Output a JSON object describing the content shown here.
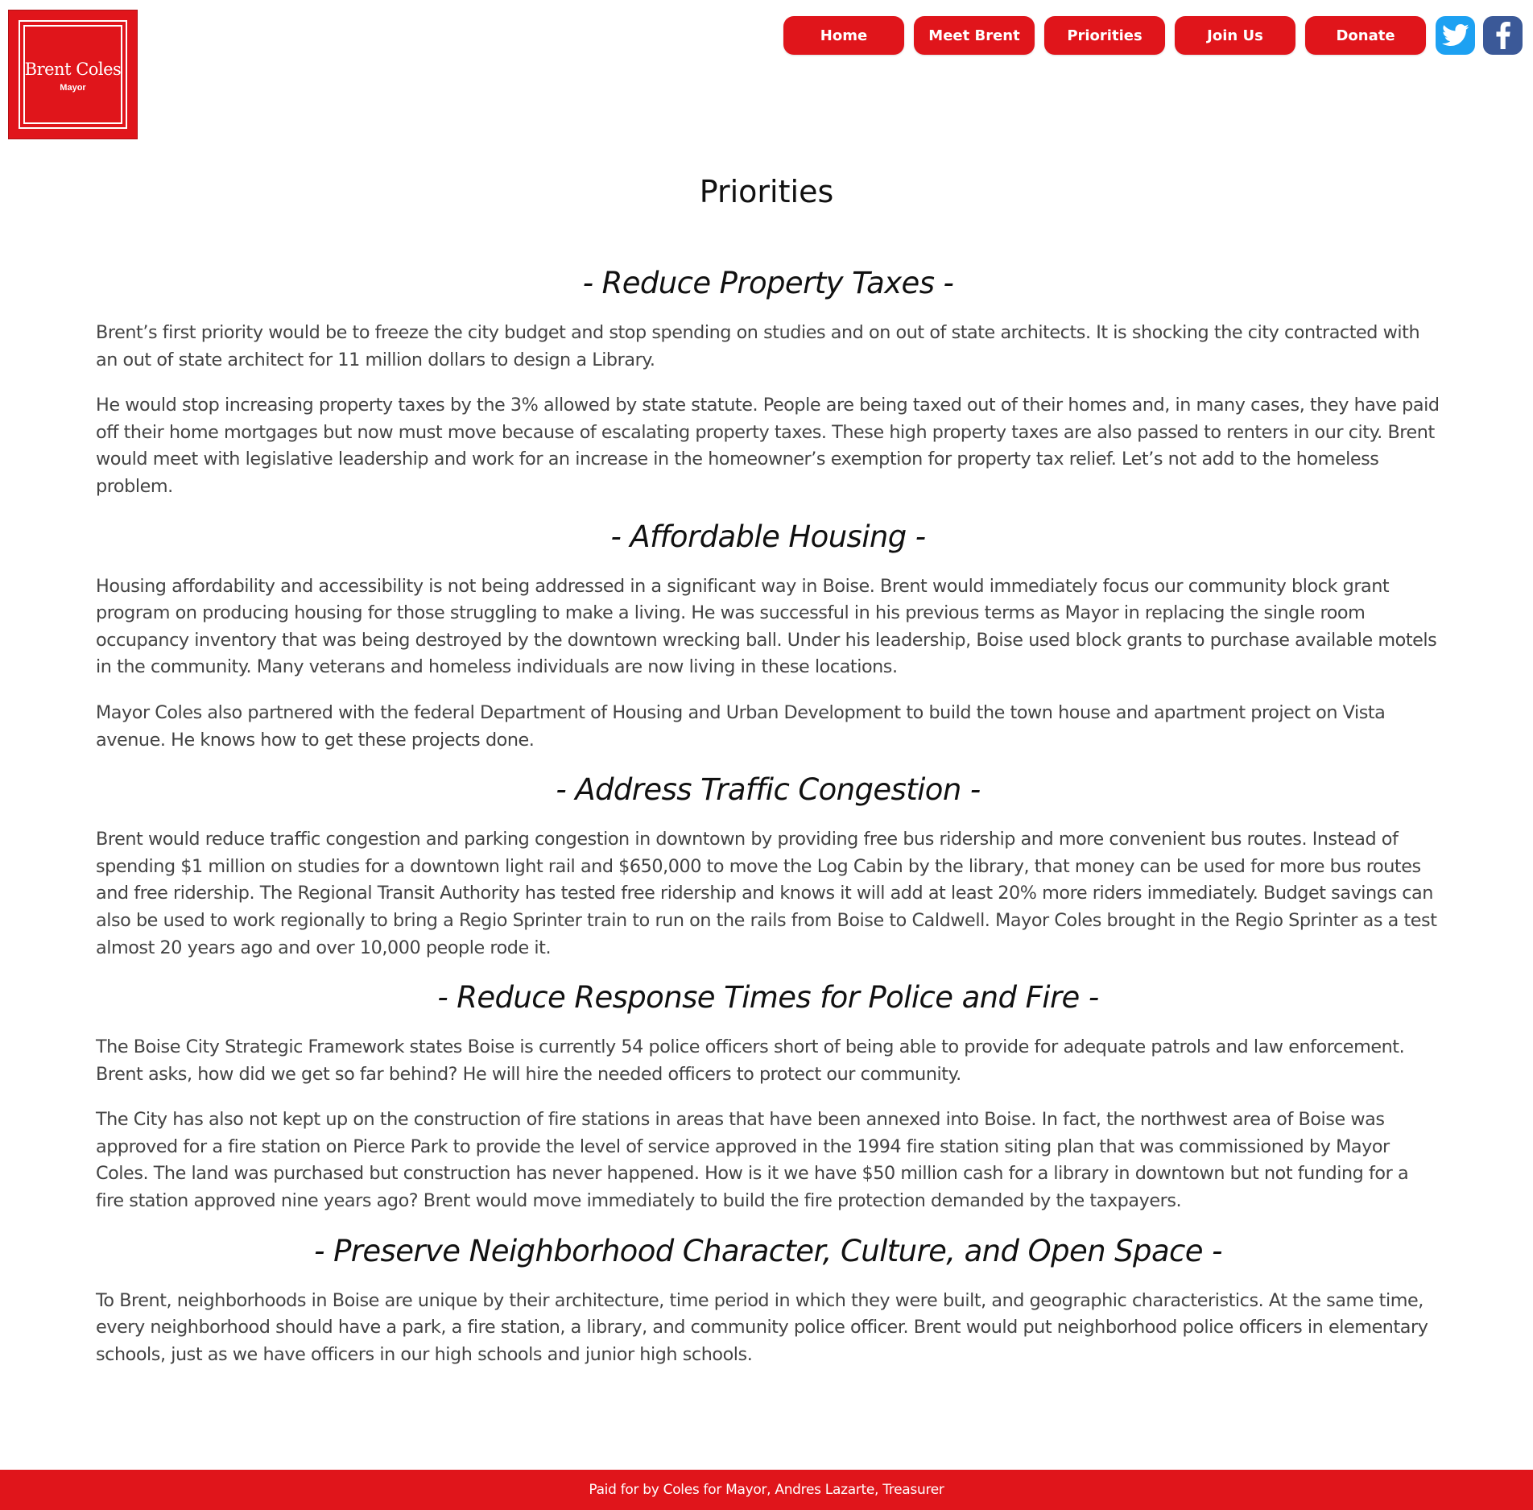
{
  "logo": {
    "name": "Brent Coles",
    "subtitle": "Mayor"
  },
  "nav": {
    "items": [
      {
        "label": "Home"
      },
      {
        "label": "Meet Brent"
      },
      {
        "label": "Priorities"
      },
      {
        "label": "Join Us"
      },
      {
        "label": "Donate"
      }
    ],
    "social": [
      {
        "icon": "twitter-icon",
        "color": "#1da1f2"
      },
      {
        "icon": "facebook-icon",
        "color": "#3b5998"
      }
    ]
  },
  "colors": {
    "brand_red": "#e0151b",
    "text": "#444444",
    "heading": "#111111"
  },
  "page": {
    "title": "Priorities"
  },
  "sections": [
    {
      "heading": "- Reduce Property Taxes -",
      "paragraphs": [
        "Brent’s first priority would be to freeze the city budget and stop spending on studies and on out of state architects. It is shocking the city contracted with an out of state architect for 11 million dollars to design a Library.",
        "He would stop increasing property taxes by the 3% allowed by state statute. People are being taxed out of their homes and, in many cases, they have paid off their home mortgages but now must move because of escalating property taxes. These high property taxes are also passed to renters in our city. Brent would meet with legislative leadership and work for an increase in the homeowner’s exemption for property tax relief. Let’s not add to the homeless problem."
      ]
    },
    {
      "heading": "- Affordable Housing -",
      "paragraphs": [
        "Housing affordability and accessibility is not being addressed in a significant way in Boise. Brent would immediately focus our community block grant program on producing housing for those struggling to make a living. He was successful in his previous terms as Mayor in replacing the single room occupancy inventory that was being destroyed by the downtown wrecking ball. Under his leadership, Boise used block grants to purchase available motels in the community. Many veterans and homeless individuals are now living in these locations.",
        "Mayor Coles also partnered with the federal Department of Housing and Urban Development to build the town house and apartment project on Vista avenue. He knows how to get these projects done."
      ]
    },
    {
      "heading": "- Address Traffic Congestion -",
      "paragraphs": [
        "Brent would reduce traffic congestion and parking congestion in downtown by providing free bus ridership and more convenient bus routes. Instead of spending $1 million on studies for a downtown light rail and $650,000 to move the Log Cabin by the library, that money can be used for more bus routes and free ridership. The Regional Transit Authority has tested free ridership and knows it will add at least 20% more riders immediately. Budget savings can also be used to work regionally to bring a Regio Sprinter train to run on the rails from Boise to Caldwell. Mayor Coles brought in the Regio Sprinter as a test almost 20 years ago and over 10,000 people rode it."
      ]
    },
    {
      "heading": "- Reduce Response Times for Police and Fire -",
      "paragraphs": [
        "The Boise City Strategic Framework states Boise is currently 54 police officers short of being able to provide for adequate patrols and law enforcement. Brent asks, how did we get so far behind? He will hire the needed officers to protect our community.",
        "The City has also not kept up on the construction of fire stations in areas that have been annexed into Boise. In fact, the northwest area of Boise was approved for a fire station on Pierce Park to provide the level of service approved in the 1994 fire station siting plan that was commissioned by Mayor Coles. The land was purchased but construction has never happened. How is it we have $50 million cash for a library in downtown but not funding for a fire station approved nine years ago? Brent would move immediately to build the fire protection demanded by the taxpayers."
      ]
    },
    {
      "heading": "- Preserve Neighborhood Character, Culture, and Open Space -",
      "paragraphs": [
        "To Brent, neighborhoods in Boise are unique by their architecture, time period in which they were built, and geographic characteristics. At the same time, every neighborhood should have a park, a fire station, a library, and community police officer. Brent would put neighborhood police officers in elementary schools, just as we have officers in our high schools and junior high schools."
      ]
    }
  ],
  "footer": {
    "text": "Paid for by Coles for Mayor, Andres Lazarte, Treasurer"
  }
}
